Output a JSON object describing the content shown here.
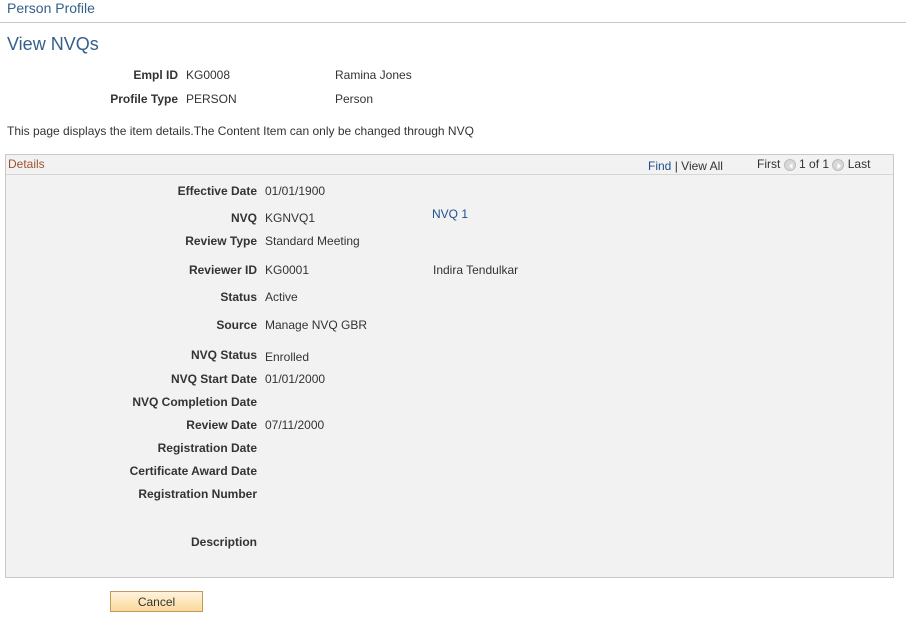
{
  "breadcrumb": "Person Profile",
  "page_title": "View NVQs",
  "header": {
    "empl_id_label": "Empl ID",
    "empl_id": "KG0008",
    "empl_name": "Ramina Jones",
    "profile_type_label": "Profile Type",
    "profile_type": "PERSON",
    "profile_type_desc": "Person"
  },
  "info_text": "This page displays the item details.The Content Item can only be changed through NVQ",
  "details": {
    "title": "Details",
    "find": "Find",
    "separator": "|",
    "view_all": "View All",
    "first": "First",
    "page_count": "1 of 1",
    "last": "Last",
    "fields": {
      "effective_date": {
        "label": "Effective Date",
        "value": "01/01/1900"
      },
      "nvq": {
        "label": "NVQ",
        "value": "KGNVQ1",
        "link": "NVQ 1"
      },
      "review_type": {
        "label": "Review Type",
        "value": "Standard Meeting"
      },
      "reviewer_id": {
        "label": "Reviewer ID",
        "value": "KG0001",
        "name": "Indira Tendulkar"
      },
      "status": {
        "label": "Status",
        "value": "Active"
      },
      "source": {
        "label": "Source",
        "value": "Manage NVQ GBR"
      },
      "nvq_status": {
        "label": "NVQ Status",
        "value": "Enrolled"
      },
      "nvq_start_date": {
        "label": "NVQ Start Date",
        "value": "01/01/2000"
      },
      "nvq_completion_date": {
        "label": "NVQ Completion Date",
        "value": ""
      },
      "review_date": {
        "label": "Review Date",
        "value": "07/11/2000"
      },
      "registration_date": {
        "label": "Registration Date",
        "value": ""
      },
      "certificate_award_date": {
        "label": "Certificate Award Date",
        "value": ""
      },
      "registration_number": {
        "label": "Registration Number",
        "value": ""
      },
      "description": {
        "label": "Description",
        "value": ""
      }
    }
  },
  "cancel_label": "Cancel",
  "icons": {
    "prev": "left-arrow-icon",
    "next": "right-arrow-icon"
  },
  "colors": {
    "title": "#35608c",
    "link": "#1f4f8a",
    "section_title": "#a0522d",
    "button": "#fbd99b"
  }
}
